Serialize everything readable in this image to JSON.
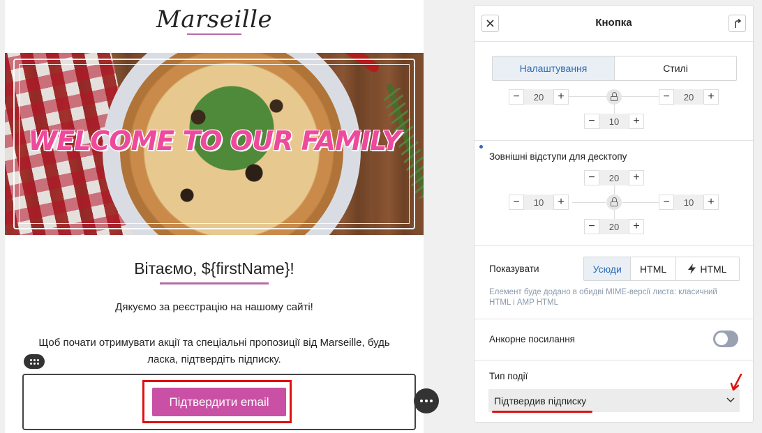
{
  "email": {
    "logo": "Marseille",
    "banner_text": "WELCOME TO OUR FAMILY",
    "greeting": "Вітаємо,  ${firstName}!",
    "thanks": "Дякуємо за реєстрацію на нашому сайті!",
    "body": "Щоб почати отримувати акції та спеціальні пропозиції від Marseille, будь ласка, підтвердіть підписку.",
    "button_label": "Підтвердити email"
  },
  "panel": {
    "title": "Кнопка",
    "tabs": [
      {
        "label": "Налаштування",
        "active": true
      },
      {
        "label": "Стилі",
        "active": false
      }
    ],
    "inner_padding": {
      "left": "20",
      "right": "20",
      "bottom": "10"
    },
    "outer_margins": {
      "label": "Зовнішні відступи для десктопу",
      "top": "20",
      "left": "10",
      "right": "10",
      "bottom": "20"
    },
    "show": {
      "label": "Показувати",
      "options": [
        {
          "label": "Усюди",
          "active": true
        },
        {
          "label": "HTML",
          "active": false
        },
        {
          "label": "HTML",
          "active": false,
          "icon": "lightning-icon"
        }
      ],
      "hint": "Елемент буде додано в обидві MIME-версії листа: класичний HTML і AMP HTML"
    },
    "anchor": {
      "label": "Анкорне посилання",
      "enabled": false
    },
    "event": {
      "label": "Тип події",
      "value": "Підтвердив підписку"
    }
  },
  "colors": {
    "accent": "#2d6bb5",
    "brand_button": "#c950a4",
    "highlight": "#e01010"
  }
}
